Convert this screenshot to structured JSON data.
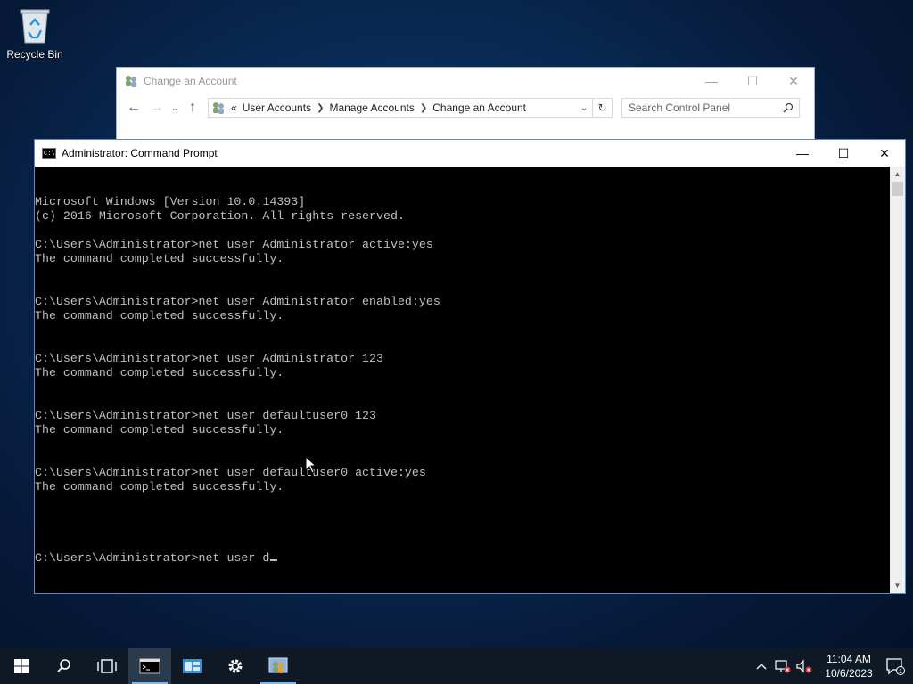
{
  "desktop": {
    "recycle_bin_label": "Recycle Bin"
  },
  "control_panel": {
    "title": "Change an Account",
    "breadcrumb_prefix": "«",
    "breadcrumbs": [
      "User Accounts",
      "Manage Accounts",
      "Change an Account"
    ],
    "search_placeholder": "Search Control Panel"
  },
  "cmd": {
    "title": "Administrator: Command Prompt",
    "lines": [
      "Microsoft Windows [Version 10.0.14393]",
      "(c) 2016 Microsoft Corporation. All rights reserved.",
      "",
      "C:\\Users\\Administrator>net user Administrator active:yes",
      "The command completed successfully.",
      "",
      "",
      "C:\\Users\\Administrator>net user Administrator enabled:yes",
      "The command completed successfully.",
      "",
      "",
      "C:\\Users\\Administrator>net user Administrator 123",
      "The command completed successfully.",
      "",
      "",
      "C:\\Users\\Administrator>net user defaultuser0 123",
      "The command completed successfully.",
      "",
      "",
      "C:\\Users\\Administrator>net user defaultuser0 active:yes",
      "The command completed successfully.",
      "",
      ""
    ],
    "prompt_line": "C:\\Users\\Administrator>net user d"
  },
  "taskbar": {
    "time": "11:04 AM",
    "date": "10/6/2023",
    "notification_count": "1"
  }
}
